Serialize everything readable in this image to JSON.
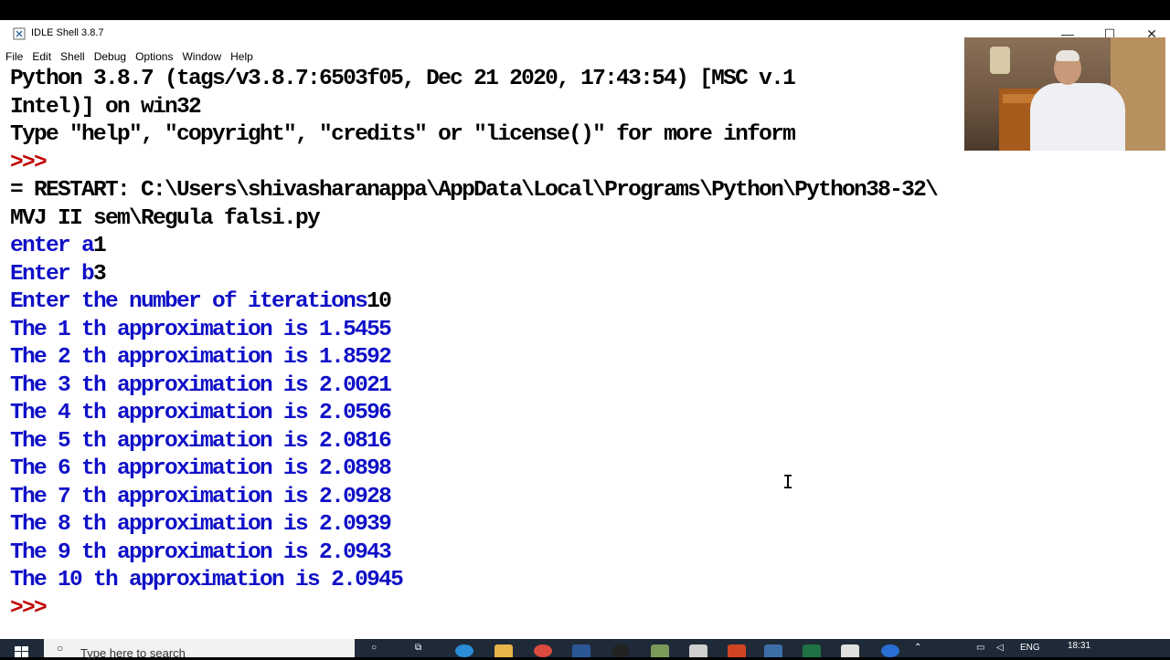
{
  "window": {
    "title": "IDLE Shell 3.8.7",
    "minimize": "—",
    "maximize": "☐",
    "close": "✕"
  },
  "menu": [
    "File",
    "Edit",
    "Shell",
    "Debug",
    "Options",
    "Window",
    "Help"
  ],
  "shell": {
    "banner1": "Python 3.8.7 (tags/v3.8.7:6503f05, Dec 21 2020, 17:43:54) [MSC v.1",
    "banner2": "Intel)] on win32",
    "banner3": "Type \"help\", \"copyright\", \"credits\" or \"license()\" for more inform",
    "prompt": ">>>",
    "restart1": "= RESTART: C:\\Users\\shivasharanappa\\AppData\\Local\\Programs\\Python\\Python38-32\\",
    "restart2": "MVJ II sem\\Regula falsi.py",
    "inputs": [
      {
        "prompt": "enter a",
        "value": "1"
      },
      {
        "prompt": "Enter b",
        "value": "3"
      },
      {
        "prompt": "Enter the number of iterations",
        "value": "10"
      }
    ],
    "approximations": [
      "The 1 th approximation is 1.5455",
      "The 2 th approximation is 1.8592",
      "The 3 th approximation is 2.0021",
      "The 4 th approximation is 2.0596",
      "The 5 th approximation is 2.0816",
      "The 6 th approximation is 2.0898",
      "The 7 th approximation is 2.0928",
      "The 8 th approximation is 2.0939",
      "The 9 th approximation is 2.0943",
      "The 10 th approximation is 2.0945"
    ],
    "final_prompt": ">>>"
  },
  "taskbar": {
    "search_placeholder": "Type here to search",
    "language": "ENG",
    "time": "18:31"
  },
  "colors": {
    "prompt": "#c00000",
    "output": "#1010c8",
    "text": "#000000"
  }
}
